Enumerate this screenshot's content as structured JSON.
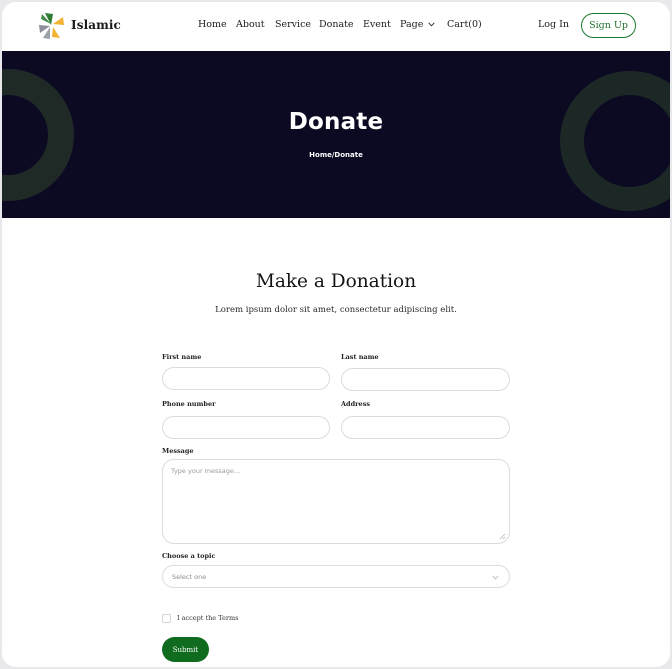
{
  "brand": {
    "name": "Islamic"
  },
  "nav": {
    "items": [
      {
        "label": "Home"
      },
      {
        "label": "About"
      },
      {
        "label": "Service"
      },
      {
        "label": "Donate"
      },
      {
        "label": "Event"
      },
      {
        "label": "Page"
      },
      {
        "label": "Cart(0)"
      }
    ],
    "login_label": "Log In",
    "signup_label": "Sign Up"
  },
  "hero": {
    "title": "Donate",
    "breadcrumb": "Home/Donate"
  },
  "donation": {
    "title": "Make a Donation",
    "subtitle": "Lorem ipsum dolor sit amet, consectetur adipiscing elit.",
    "fields": {
      "first_name": {
        "label": "First name",
        "value": ""
      },
      "last_name": {
        "label": "Last name",
        "value": ""
      },
      "phone": {
        "label": "Phone number",
        "value": ""
      },
      "address": {
        "label": "Address",
        "value": ""
      },
      "message": {
        "label": "Message",
        "placeholder": "Type your message...",
        "value": ""
      },
      "topic": {
        "label": "Choose a topic",
        "selected": "Select one"
      }
    },
    "terms_label": "I accept the Terms",
    "terms_checked": false,
    "submit_label": "Submit"
  },
  "colors": {
    "accent": "#0f6b1e",
    "hero_bg": "#0b0a22",
    "logo_green": "#2e7d32",
    "logo_yellow": "#f2b233",
    "logo_grey": "#8a8f9a"
  },
  "icons": {
    "logo": "pinwheel-logo-icon",
    "page_menu": "chevron-down-icon",
    "topic_select": "chevron-down-icon"
  }
}
